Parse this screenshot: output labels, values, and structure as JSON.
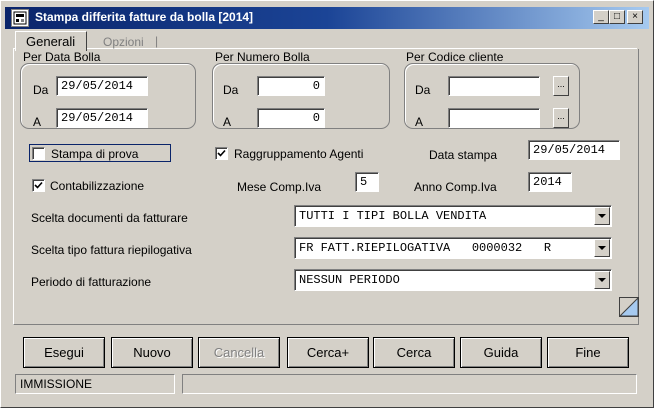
{
  "window": {
    "title": "Stampa differita fatture da bolla [2014]",
    "controls": {
      "minimize": "_",
      "maximize": "□",
      "close": "×"
    }
  },
  "tabs": [
    {
      "label": "Generali",
      "active": true
    },
    {
      "label": "Opzioni",
      "active": false
    }
  ],
  "tab_separator": "|",
  "groups": {
    "data_bolla": {
      "title": "Per Data Bolla",
      "da_label": "Da",
      "a_label": "A",
      "da_value": "29/05/2014",
      "a_value": "29/05/2014"
    },
    "numero_bolla": {
      "title": "Per Numero Bolla",
      "da_label": "Da",
      "a_label": "A",
      "da_value": "0",
      "a_value": "0"
    },
    "codice_cliente": {
      "title": "Per Codice cliente",
      "da_label": "Da",
      "a_label": "A",
      "da_value": "",
      "a_value": "",
      "lookup_label": "..."
    }
  },
  "options": {
    "stampa_prova": {
      "label": "Stampa di prova",
      "checked": false
    },
    "raggruppamento": {
      "label": "Raggruppamento Agenti",
      "checked": true
    },
    "contabilizzazione": {
      "label": "Contabilizzazione",
      "checked": true
    },
    "data_stampa_label": "Data stampa",
    "data_stampa_value": "29/05/2014",
    "mese_label": "Mese Comp.Iva",
    "mese_value": "5",
    "anno_label": "Anno Comp.Iva",
    "anno_value": "2014"
  },
  "selects": {
    "documenti": {
      "label": "Scelta documenti da fatturare",
      "value": "TUTTI I TIPI BOLLA VENDITA"
    },
    "tipo_fattura": {
      "label": "Scelta tipo fattura riepilogativa",
      "value": "FR FATT.RIEPILOGATIVA   0000032   R"
    },
    "periodo": {
      "label": "Periodo di fatturazione",
      "value": "NESSUN PERIODO"
    }
  },
  "buttons": {
    "esegui": "Esegui",
    "nuovo": "Nuovo",
    "cancella": "Cancella",
    "cerca_plus": "Cerca+",
    "cerca": "Cerca",
    "guida": "Guida",
    "fine": "Fine"
  },
  "status": {
    "mode": "IMMISSIONE",
    "message": ""
  },
  "colors": {
    "titlebar_start": "#0a246a",
    "titlebar_end": "#a6caf0",
    "face": "#d4d0c8"
  }
}
